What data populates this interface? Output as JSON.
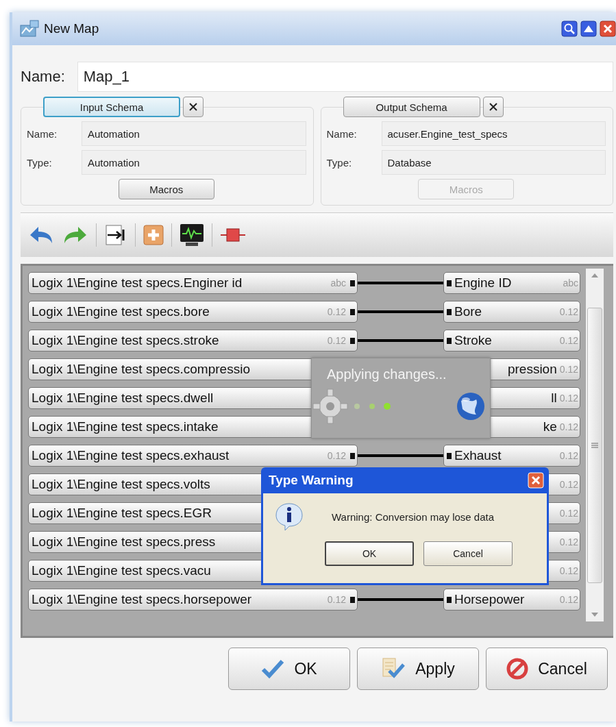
{
  "window": {
    "title": "New Map"
  },
  "name_field": {
    "label": "Name:",
    "value": "Map_1"
  },
  "schemas": [
    {
      "button": "Input Schema",
      "focused": true,
      "fields": [
        {
          "label": "Name:",
          "value": "Automation"
        },
        {
          "label": "Type:",
          "value": "Automation"
        }
      ],
      "macros": {
        "label": "Macros",
        "disabled": false
      }
    },
    {
      "button": "Output Schema",
      "focused": false,
      "fields": [
        {
          "label": "Name:",
          "value": "acuser.Engine_test_specs"
        },
        {
          "label": "Type:",
          "value": "Database"
        }
      ],
      "macros": {
        "label": "Macros",
        "disabled": true
      }
    }
  ],
  "mappings": [
    {
      "source": "Logix 1\\Engine test specs.Enginer id",
      "source_type": "abc",
      "target": "Engine ID",
      "target_type": "abc",
      "target_clipped": false,
      "connected": true
    },
    {
      "source": "Logix 1\\Engine test specs.bore",
      "source_type": "0.12",
      "target": "Bore",
      "target_type": "0.12",
      "target_clipped": false,
      "connected": true
    },
    {
      "source": "Logix 1\\Engine test specs.stroke",
      "source_type": "0.12",
      "target": "Stroke",
      "target_type": "0.12",
      "target_clipped": false,
      "connected": true
    },
    {
      "source": "Logix 1\\Engine test specs.compressio",
      "target": "pression",
      "target_type": "0.12",
      "target_clipped": true
    },
    {
      "source": "Logix 1\\Engine test specs.dwell",
      "target": "ll",
      "target_type": "0.12",
      "target_clipped": true
    },
    {
      "source": "Logix 1\\Engine test specs.intake",
      "target": "ke",
      "target_type": "0.12",
      "target_clipped": true
    },
    {
      "source": "Logix 1\\Engine test specs.exhaust",
      "source_type": "0.12",
      "target": "Exhaust",
      "target_type": "0.12",
      "target_clipped": false,
      "connected": true
    },
    {
      "source": "Logix 1\\Engine test specs.volts",
      "target_type": "0.12"
    },
    {
      "source": "Logix 1\\Engine test specs.EGR",
      "target_type": "0.12"
    },
    {
      "source": "Logix 1\\Engine test specs.press",
      "target_type": "0.12"
    },
    {
      "source": "Logix 1\\Engine test specs.vacu",
      "target_type": "0.12"
    },
    {
      "source": "Logix 1\\Engine test specs.horsepower",
      "source_type": "0.12",
      "target": "Horsepower",
      "target_type": "0.12",
      "target_clipped": false,
      "connected": true
    }
  ],
  "progress": {
    "message": "Applying changes..."
  },
  "dialog": {
    "title": "Type Warning",
    "message": "Warning: Conversion may lose data",
    "buttons": [
      {
        "label": "OK",
        "default": true
      },
      {
        "label": "Cancel",
        "default": false
      }
    ]
  },
  "buttons": [
    {
      "label": "OK",
      "kind": "ok"
    },
    {
      "label": "Apply",
      "kind": "apply"
    },
    {
      "label": "Cancel",
      "kind": "cancel"
    }
  ]
}
